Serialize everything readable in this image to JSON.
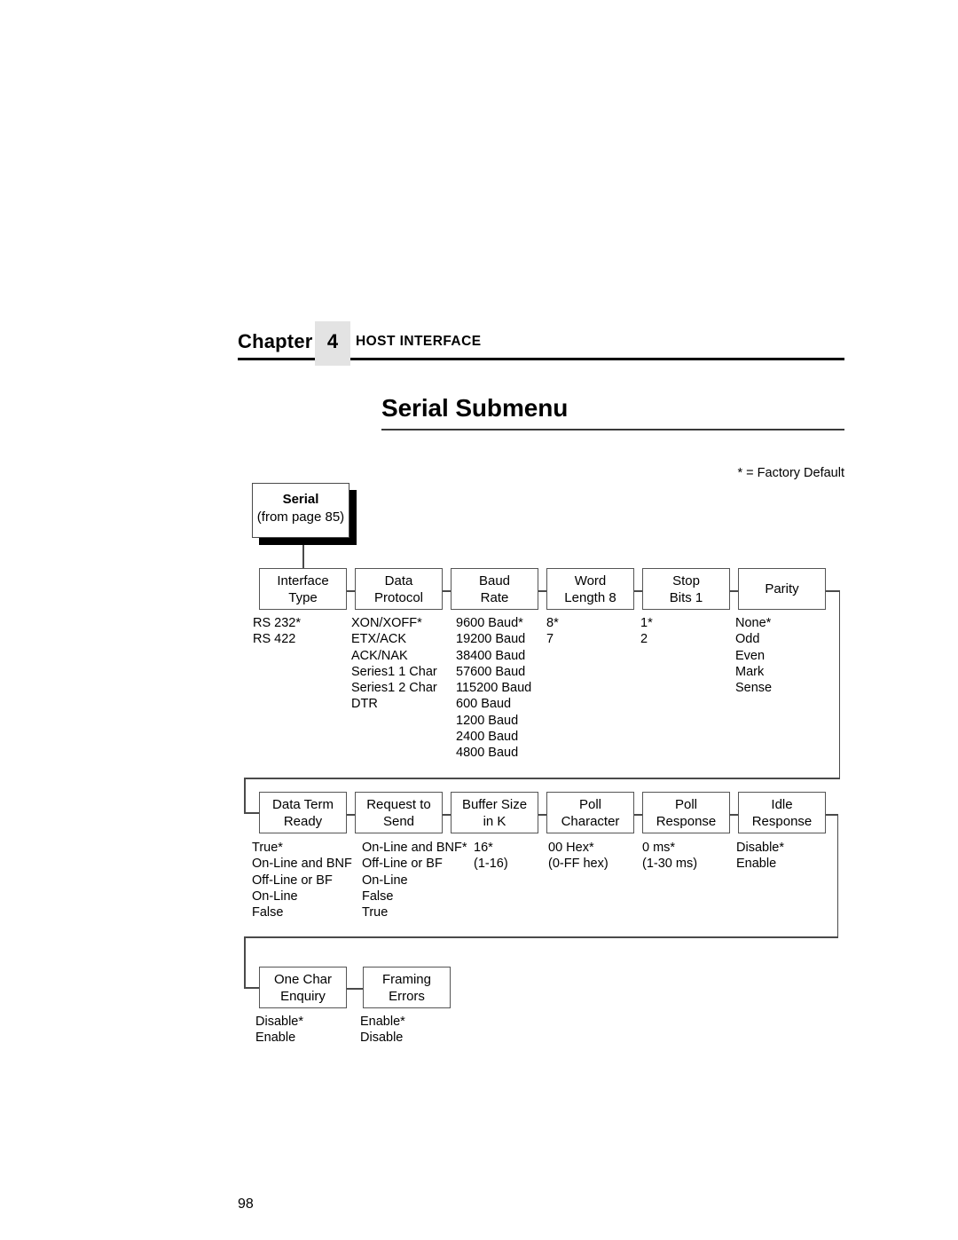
{
  "header": {
    "chapter_word": "Chapter",
    "chapter_number": "4",
    "title": "HOST INTERFACE"
  },
  "section": {
    "title": "Serial Submenu"
  },
  "legend": {
    "factory_default": "* = Factory Default"
  },
  "root": {
    "line1": "Serial",
    "line2": "(from page 85)"
  },
  "rows": [
    {
      "nodes": [
        {
          "line1": "Interface",
          "line2": "Type",
          "options": [
            "RS 232*",
            "RS 422"
          ]
        },
        {
          "line1": "Data",
          "line2": "Protocol",
          "options": [
            "XON/XOFF*",
            "ETX/ACK",
            "ACK/NAK",
            "Series1 1 Char",
            "Series1 2 Char",
            "DTR"
          ]
        },
        {
          "line1": "Baud",
          "line2": "Rate",
          "options": [
            "9600 Baud*",
            "19200 Baud",
            "38400 Baud",
            "57600 Baud",
            "115200 Baud",
            "600 Baud",
            "1200 Baud",
            "2400 Baud",
            "4800 Baud"
          ]
        },
        {
          "line1": "Word",
          "line2": "Length 8",
          "options": [
            "8*",
            "7"
          ]
        },
        {
          "line1": "Stop",
          "line2": "Bits 1",
          "options": [
            "1*",
            "2"
          ]
        },
        {
          "line1": "Parity",
          "line2": "",
          "options": [
            "None*",
            "Odd",
            "Even",
            "Mark",
            "Sense"
          ]
        }
      ]
    },
    {
      "nodes": [
        {
          "line1": "Data Term",
          "line2": "Ready",
          "options": [
            "True*",
            "On-Line and BNF",
            "Off-Line or BF",
            "On-Line",
            "False"
          ]
        },
        {
          "line1": "Request to",
          "line2": "Send",
          "options": [
            "On-Line and BNF*",
            "Off-Line or BF",
            "On-Line",
            "False",
            "True"
          ]
        },
        {
          "line1": "Buffer Size",
          "line2": "in K",
          "options": [
            "16*",
            "(1-16)"
          ]
        },
        {
          "line1": "Poll",
          "line2": "Character",
          "options": [
            "00 Hex*",
            "(0-FF hex)"
          ]
        },
        {
          "line1": "Poll",
          "line2": "Response",
          "options": [
            "0 ms*",
            "(1-30 ms)"
          ]
        },
        {
          "line1": "Idle",
          "line2": "Response",
          "options": [
            "Disable*",
            "Enable"
          ]
        }
      ]
    },
    {
      "nodes": [
        {
          "line1": "One Char",
          "line2": "Enquiry",
          "options": [
            "Disable*",
            "Enable"
          ]
        },
        {
          "line1": "Framing",
          "line2": "Errors",
          "options": [
            "Enable*",
            "Disable"
          ]
        }
      ]
    }
  ],
  "footer": {
    "page_number": "98"
  }
}
